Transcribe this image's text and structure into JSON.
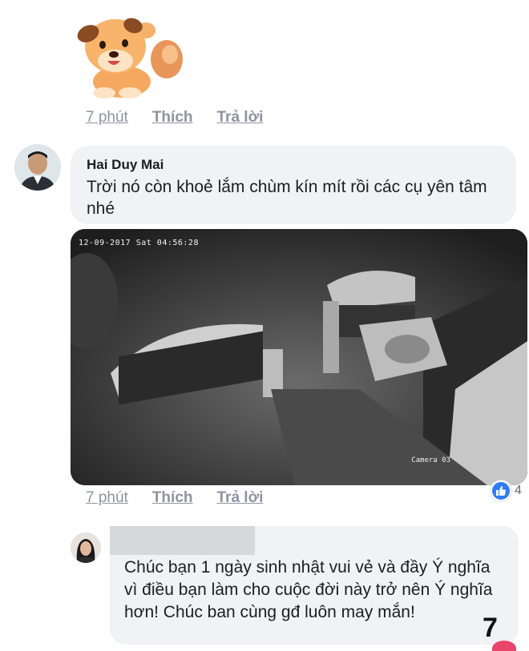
{
  "comment1": {
    "actions": {
      "time": "7 phút",
      "like": "Thích",
      "reply": "Trả lời"
    }
  },
  "comment2": {
    "author": "Hai Duy Mai",
    "text": "Trời nó còn khoẻ lắm chùm kín mít rồi các cụ yên tâm nhé",
    "cctv": {
      "timestamp": "12-09-2017 Sat 04:56:28",
      "camera": "Camera 03"
    },
    "actions": {
      "time": "7 phút",
      "like": "Thích",
      "reply": "Trả lời"
    },
    "reaction": {
      "icon": "like-icon",
      "count": "4",
      "color": "#2e7cf6"
    }
  },
  "comment3": {
    "text": "Chúc bạn 1 ngày sinh nhật vui vẻ và đầy Ý nghĩa vì điều bạn làm cho cuộc đời này trở nên Ý nghĩa hơn! Chúc ban cùng gđ luôn may mắn!"
  },
  "page_number": "7"
}
